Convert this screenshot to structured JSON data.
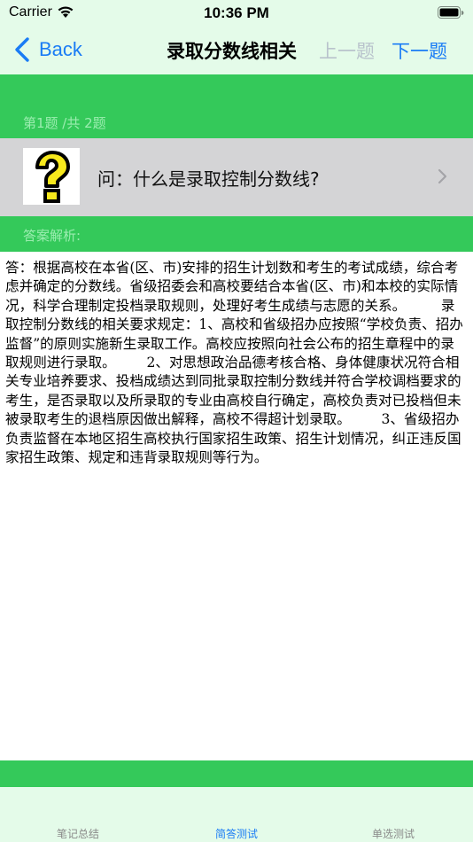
{
  "status_bar": {
    "carrier": "Carrier",
    "time": "10:36 PM",
    "wifi_icon": "wifi-icon",
    "battery_icon": "battery-icon"
  },
  "nav": {
    "back_label": "Back",
    "title": "录取分数线相关",
    "prev_label": "上一题",
    "next_label": "下一题"
  },
  "progress": "第1题 /共 2题",
  "question": {
    "text": "问：什么是录取控制分数线?",
    "icon": "question-mark-icon"
  },
  "answer": {
    "header": "答案解析:",
    "body": "答：根据高校在本省(区、市)安排的招生计划数和考生的考试成绩，综合考虑并确定的分数线。省级招委会和高校要结合本省(区、市)和本校的实际情况，科学合理制定投档录取规则，处理好考生成绩与志愿的关系。        录取控制分数线的相关要求规定：1、高校和省级招办应按照“学校负责、招办监督”的原则实施新生录取工作。高校应按照向社会公布的招生章程中的录取规则进行录取。       2、对思想政治品德考核合格、身体健康状况符合相关专业培养要求、投档成绩达到同批录取控制分数线并符合学校调档要求的考生，是否录取以及所录取的专业由高校自行确定，高校负责对已投档但未被录取考生的退档原因做出解释，高校不得超计划录取。       3、省级招办负责监督在本地区招生高校执行国家招生政策、招生计划情况，纠正违反国家招生政策、规定和违背录取规则等行为。"
  },
  "tabs": [
    {
      "label": "笔记总结",
      "active": false
    },
    {
      "label": "简答测试",
      "active": true
    },
    {
      "label": "单选测试",
      "active": false
    }
  ],
  "colors": {
    "green": "#34c95a",
    "light_green": "#e4fbe9",
    "blue": "#1a7cf5",
    "gray_row": "#d4d4d6",
    "yellow": "#f7e81c"
  }
}
